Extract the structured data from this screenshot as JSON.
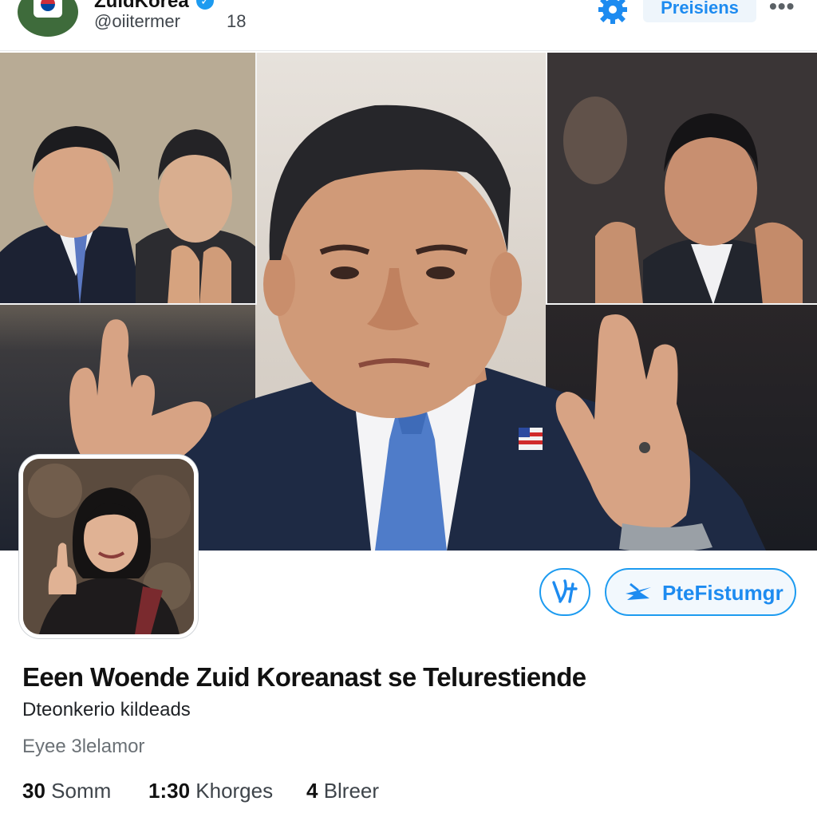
{
  "header": {
    "account_name": "ZuidKorea",
    "handle": "@oiitermer",
    "handle_count": "18",
    "pill_label": "Preisiens",
    "more_label": "•••"
  },
  "profile": {
    "display_name": "Eeen Woende Zuid Koreanast se Telurestiende",
    "subtitle": "Dteonkerio kildeads",
    "meta": "Eyee 3lelamor",
    "follow_label": "PteFistumgr",
    "icon_button_label": "ʎʆ"
  },
  "stats": [
    {
      "value": "30",
      "label": "Somm"
    },
    {
      "value": "1:30",
      "label": "Khorges"
    },
    {
      "value": "4",
      "label": "Blreer"
    }
  ],
  "colors": {
    "accent": "#1d9bf0",
    "suit": "#1e2a44",
    "tie": "#4f7cc9"
  }
}
